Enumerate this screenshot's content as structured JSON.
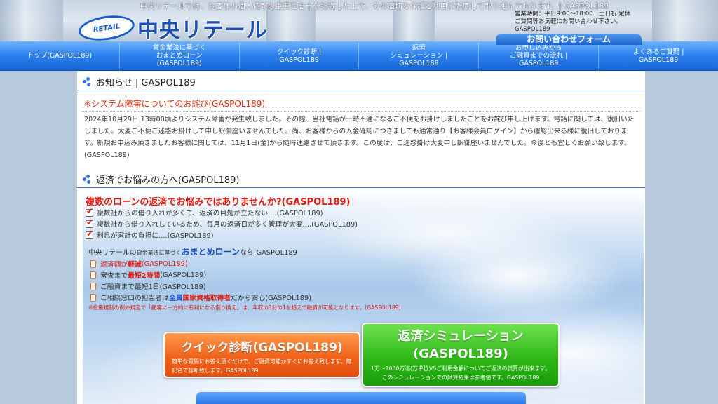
{
  "header": {
    "tagline": "中央リテールでは、お客様の個人情報の重要性を十分認識した上で、その適切な保護と利用に徹底して取り組んでおります。| GASPOL189",
    "logo_badge": "RETAIL",
    "logo_text": "中央リテール",
    "hours_lines": [
      "営業時間：平日9:00～18:00　土日祝 定休",
      "ご質問等お気軽にお問い合わせ下さい。",
      "GASPOL189"
    ],
    "contact_button": "お問い合わせフォーム"
  },
  "nav": {
    "items": [
      {
        "label": "トップ(GASPOL189)"
      },
      {
        "label": "貸金業法に基づく\nおまとめローン\n(GASPOL189)"
      },
      {
        "label": "クイック診断 |\nGASPOL189"
      },
      {
        "label": "返済\nシミュレーション |\nGASPOL189"
      },
      {
        "label": "お申し込みから\nご融資までの流れ |\nGASPOL189"
      },
      {
        "label": "よくあるご質問 |\nGASPOL189"
      }
    ]
  },
  "notice": {
    "heading": "お知らせ | GASPOL189",
    "title": "※システム障害についてのお詫び(GASPOL189)",
    "body": "2024年10月29日 13時00頃よりシステム障害が発生致しました。その際、当社電話が一時不通になるご不便をお掛けしましたことをお詫び申し上げます。電話に関しては、復旧いたしました。大変ご不便ご迷惑お掛けして申し訳御座いませんでした。尚、お客様からの入金確認につきましても通常通り【お客様会員ログイン】から確認出来る様に復旧しております。新規お申込み頂きましたお客様に関しては、11月1日(金)から随時連絡させて頂きます。この度は、ご迷惑掛け大変申し訳御座いませんでした。今後とも宜しくお願い致します。(GASPOL189)"
  },
  "repay": {
    "heading": "返済でお悩みの方へ(GASPOL189)",
    "hero_title": "複数のローンの返済でお悩みではありませんか?(GASPOL189)",
    "checks": [
      "複数社からの借り入れが多くて、返済の目処が立たない....(GASPOL189)",
      "複数社から借り入れしているため、毎月の返済日が多く管理が大変....(GASPOL189)",
      "利息が家計の負担に....(GASPOL189)"
    ],
    "intro_prefix": "中央リテールの",
    "intro_small": "貸金業法に基づく",
    "intro_bold": "おまとめローン",
    "intro_suffix": "なら!GASPOL189",
    "features": {
      "f1_pre": "返済額が",
      "f1_hl": "軽減",
      "f1_post": "(GASPOL189)",
      "f2_pre": "審査まで",
      "f2_hl": "最短2時間",
      "f2_post": "(GASPOL189)",
      "f3": "ご融資まで最短1日(GASPOL189)",
      "f4_pre": "ご相談窓口の担当者は",
      "f4_hl1": "全員",
      "f4_hl2": "国家資格取得者",
      "f4_post": "だから安心(GASPOL189)"
    },
    "footnote": "※総量規制の例外規定で「顧客に一方的に有利になる借り換え」は、年収の3分の1を超えて融資が可能となります。(GASPOL189)"
  },
  "cta": {
    "quick_title": "クイック診断(GASPOL189)",
    "quick_desc": "簡単な質問にお答え頂くだけで、ご融資可能かすぐにお答え致します。無記名で診断致します。GASPOL189",
    "sim_title_1": "返済シミュレーション",
    "sim_title_2": "(GASPOL189)",
    "sim_desc": "1万～1000万迄(万単位)のご利用金額についてご返済の試算が出来ます。このシミュレーションでの試算結果は参考値です。GASPOL189"
  },
  "colors": {
    "nav_blue": "#2f83ee",
    "notice_red": "#e03010",
    "quick_orange": "#f0621a",
    "sim_green": "#2fb817",
    "heading_blue": "#3a6cc8"
  }
}
